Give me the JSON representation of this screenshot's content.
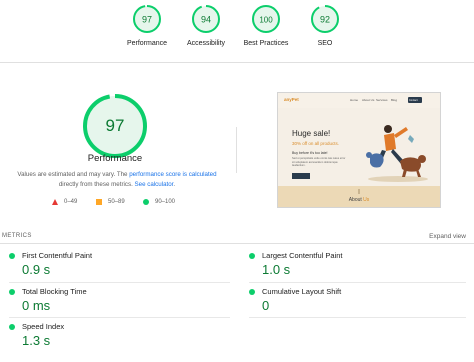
{
  "categories": [
    {
      "score": "97",
      "label": "Performance",
      "fraction": 0.97
    },
    {
      "score": "94",
      "label": "Accessibility",
      "fraction": 0.94
    },
    {
      "score": "100",
      "label": "Best Practices",
      "fraction": 1.0
    },
    {
      "score": "92",
      "label": "SEO",
      "fraction": 0.92
    }
  ],
  "main": {
    "score": "97",
    "fraction": 0.97,
    "title": "Performance",
    "desc_prefix": "Values are estimated and may vary. The ",
    "desc_link1": "performance score is calculated",
    "desc_mid": " directly from these metrics. ",
    "desc_link2": "See calculator",
    "desc_suffix": "."
  },
  "legend": {
    "fail": "0–49",
    "average": "50–89",
    "pass": "90–100"
  },
  "thumbnail": {
    "logo": "anyPet",
    "nav_links": [
      "Home",
      "About Us",
      "Services",
      "Blog",
      "Contact"
    ],
    "headline": "Huge sale!",
    "offer": "30% off on all products.",
    "subhead": "Buy before it's too late!",
    "body": "Sed ut perspiciatis unde omnis iste natus error sit voluptatem accusantium doloremque laudantium.",
    "about_prefix": "About ",
    "about_highlight": "Us"
  },
  "metrics": {
    "title": "METRICS",
    "expand_label": "Expand view",
    "items": [
      {
        "name": "First Contentful Paint",
        "value": "0.9 s"
      },
      {
        "name": "Largest Contentful Paint",
        "value": "1.0 s"
      },
      {
        "name": "Total Blocking Time",
        "value": "0 ms"
      },
      {
        "name": "Cumulative Layout Shift",
        "value": "0"
      },
      {
        "name": "Speed Index",
        "value": "1.3 s"
      }
    ]
  },
  "colors": {
    "pass": "#0cce6b",
    "pass_text": "#0c7a33",
    "pass_bg": "#e6f6ec",
    "average": "#ffa726",
    "fail": "#e53935",
    "link": "#1a73e8"
  }
}
